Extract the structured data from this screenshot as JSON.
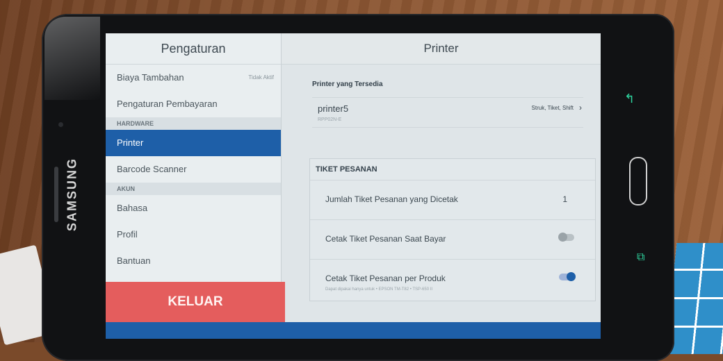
{
  "device": {
    "brand": "SAMSUNG",
    "icons": {
      "back": "back-arrow-icon",
      "recents": "recents-icon"
    }
  },
  "left_panel": {
    "title": "Pengaturan",
    "items": [
      {
        "label": "Biaya Tambahan",
        "sub": "Tidak Aktif"
      },
      {
        "label": "Pengaturan Pembayaran"
      }
    ],
    "section_hardware": "HARDWARE",
    "hardware_items": [
      {
        "label": "Printer",
        "active": true
      },
      {
        "label": "Barcode Scanner"
      }
    ],
    "section_account": "AKUN",
    "account_items": [
      {
        "label": "Bahasa"
      },
      {
        "label": "Profil"
      },
      {
        "label": "Bantuan"
      }
    ],
    "logout_label": "KELUAR"
  },
  "right_panel": {
    "title": "Printer",
    "available_title": "Printer yang Tersedia",
    "printer": {
      "name": "printer5",
      "model": "RPP02N-E",
      "types": "Struk, Tiket, Shift"
    },
    "ticket": {
      "title": "TIKET PESANAN",
      "rows": [
        {
          "label": "Jumlah Tiket Pesanan yang Dicetak",
          "value": "1"
        },
        {
          "label": "Cetak Tiket Pesanan Saat Bayar",
          "toggle": false
        },
        {
          "label": "Cetak Tiket Pesanan per Produk",
          "toggle": true,
          "note": "Dapat dipakai hanya untuk • EPSON TM-T82 • TSP-650 II"
        }
      ]
    }
  },
  "colors": {
    "accent": "#1e5fa8",
    "logout": "#e45d5d"
  }
}
